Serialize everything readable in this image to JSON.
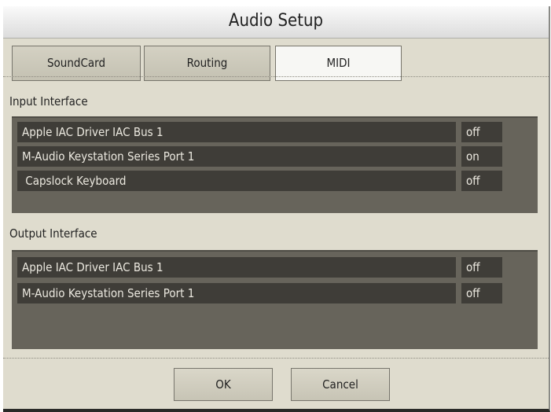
{
  "title": "Audio Setup",
  "tabs": [
    {
      "label": "SoundCard"
    },
    {
      "label": "Routing"
    },
    {
      "label": "MIDI",
      "active": true
    }
  ],
  "input": {
    "label": "Input Interface",
    "devices": [
      {
        "name": "Apple IAC Driver IAC Bus 1",
        "state": "off"
      },
      {
        "name": "M-Audio Keystation Series Port 1",
        "state": "on"
      },
      {
        "name": " Capslock Keyboard",
        "state": "off"
      }
    ]
  },
  "output": {
    "label": "Output Interface",
    "devices": [
      {
        "name": "Apple IAC Driver IAC Bus 1",
        "state": "off"
      },
      {
        "name": "M-Audio Keystation Series Port 1",
        "state": "off"
      }
    ]
  },
  "buttons": {
    "ok": "OK",
    "cancel": "Cancel"
  }
}
